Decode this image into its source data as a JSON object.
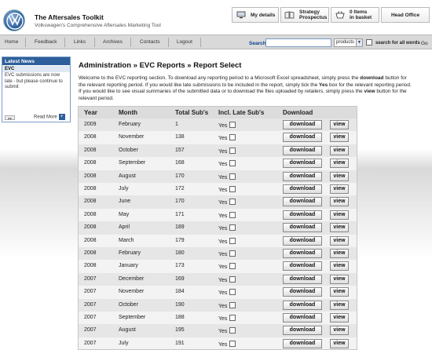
{
  "header": {
    "title": "The Aftersales Toolkit",
    "subtitle": "Volkswagen's Comprehensive Aftersales Marketing Tool",
    "my_details": "My details",
    "strategy_line1": "Strategy",
    "strategy_line2": "Prospectus",
    "basket_line1": "0 Items",
    "basket_line2": "in basket",
    "head_office": "Head Office"
  },
  "nav": {
    "items": [
      "Home",
      "Feedback",
      "Links",
      "Archives",
      "Contacts",
      "Logout"
    ],
    "search_label": "Search",
    "search_value": "",
    "search_scope": "products",
    "search_all_label": "search for all words",
    "go": "Go"
  },
  "news": {
    "heading": "Latest News",
    "item_title": "EVC",
    "item_text": "EVC submissions are now late - but please continue to submit",
    "controls": "◂ ▸",
    "read_more": "Read More"
  },
  "main": {
    "breadcrumb": "Administration » EVC Reports » Report Select",
    "intro_1": "Welcome to the EVC reporting section. To download any reporting period to a Microsoft Excel spreadsheet, simply press the ",
    "intro_download": "download",
    "intro_2": " button for the relevant reporting period. If you would like late submissions to be included in the report, simply tick the ",
    "intro_yes": "Yes",
    "intro_3": " box for the relevant reporting period. If you would like to see visual summaries of the submitted data or to download the files uploaded by retailers, simply press the ",
    "intro_view": "view",
    "intro_4": " button for the relevant period."
  },
  "table": {
    "headers": [
      "Year",
      "Month",
      "Total Sub's",
      "Incl. Late Sub's",
      "Download"
    ],
    "yes_label": "Yes",
    "download_label": "download",
    "view_label": "view",
    "rows": [
      {
        "year": "2009",
        "month": "February",
        "total": "1"
      },
      {
        "year": "2008",
        "month": "November",
        "total": "138"
      },
      {
        "year": "2008",
        "month": "October",
        "total": "157"
      },
      {
        "year": "2008",
        "month": "September",
        "total": "168"
      },
      {
        "year": "2008",
        "month": "August",
        "total": "170"
      },
      {
        "year": "2008",
        "month": "July",
        "total": "172"
      },
      {
        "year": "2008",
        "month": "June",
        "total": "170"
      },
      {
        "year": "2008",
        "month": "May",
        "total": "171"
      },
      {
        "year": "2008",
        "month": "April",
        "total": "189"
      },
      {
        "year": "2008",
        "month": "March",
        "total": "179"
      },
      {
        "year": "2008",
        "month": "February",
        "total": "180"
      },
      {
        "year": "2008",
        "month": "January",
        "total": "173"
      },
      {
        "year": "2007",
        "month": "December",
        "total": "169"
      },
      {
        "year": "2007",
        "month": "November",
        "total": "184"
      },
      {
        "year": "2007",
        "month": "October",
        "total": "190"
      },
      {
        "year": "2007",
        "month": "September",
        "total": "188"
      },
      {
        "year": "2007",
        "month": "August",
        "total": "195"
      },
      {
        "year": "2007",
        "month": "July",
        "total": "191"
      }
    ]
  },
  "colors": {
    "accent": "#2d5f9a",
    "nav_bg": "#d9d9d9",
    "row_odd": "#e6e6e6",
    "row_even": "#f3f3f3"
  }
}
